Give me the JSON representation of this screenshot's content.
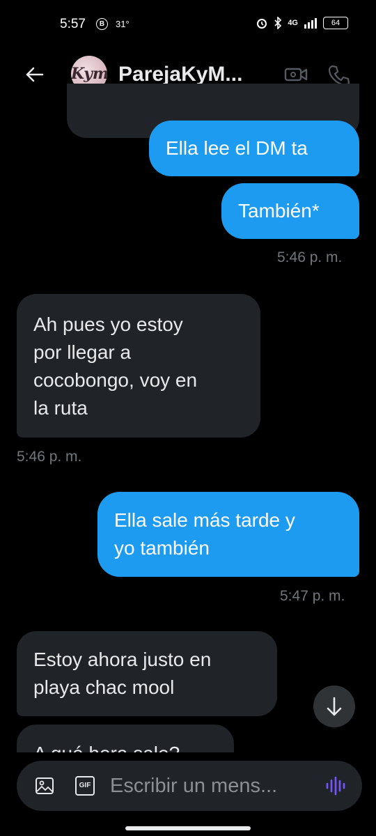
{
  "status_bar": {
    "time": "5:57",
    "notification_letter": "B",
    "temperature": "31°",
    "network": "4G",
    "battery": "64"
  },
  "header": {
    "back_icon": "arrow-left-icon",
    "avatar_text": "Kym",
    "title": "ParejaKyM...",
    "video_icon": "video-camera-icon",
    "phone_icon": "phone-icon"
  },
  "messages": [
    {
      "id": "m1",
      "side": "sent",
      "text": "Ella lee el DM ta"
    },
    {
      "id": "m2",
      "side": "sent",
      "text": "También*",
      "time": "5:46 p. m."
    },
    {
      "id": "m3",
      "side": "received",
      "lines": [
        "Ah pues yo estoy",
        "por llegar a",
        "cocobongo, voy en",
        "la ruta"
      ],
      "time": "5:46 p. m."
    },
    {
      "id": "m4",
      "side": "sent",
      "lines": [
        "Ella sale más tarde y",
        "yo también"
      ],
      "time": "5:47 p. m."
    },
    {
      "id": "m5",
      "side": "received",
      "lines": [
        "Estoy ahora justo en",
        "playa chac mool"
      ]
    },
    {
      "id": "m6",
      "side": "received",
      "text": "A qué hora sale?"
    }
  ],
  "scroll_button": {
    "icon": "arrow-down-icon"
  },
  "composer": {
    "placeholder": "Escribir un mens...",
    "image_icon": "image-icon",
    "gif_label": "GIF",
    "voice_icon": "voice-wave-icon"
  },
  "colors": {
    "sent_bubble": "#1d9bf0",
    "received_bubble": "#202327",
    "voice_accent": "#7856ff"
  }
}
